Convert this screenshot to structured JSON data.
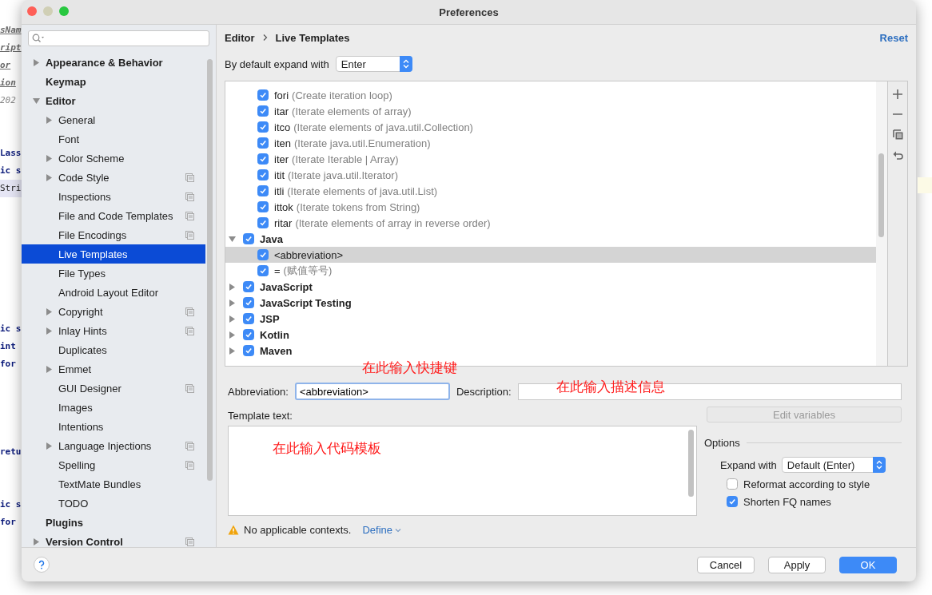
{
  "background_code": [
    {
      "kind": "doc",
      "text": "sNam"
    },
    {
      "kind": "doc",
      "text": "ript"
    },
    {
      "kind": "doc",
      "text": "or"
    },
    {
      "kind": "doc",
      "text": "ion"
    },
    {
      "kind": "comment",
      "text": "202"
    },
    {
      "kind": "blank"
    },
    {
      "kind": "blank"
    },
    {
      "kind": "code",
      "text": "Lass"
    },
    {
      "kind": "code",
      "text": "ic s"
    },
    {
      "kind": "current",
      "text": "Stri"
    },
    {
      "kind": "blank"
    },
    {
      "kind": "blank"
    },
    {
      "kind": "blank"
    },
    {
      "kind": "blank"
    },
    {
      "kind": "blank"
    },
    {
      "kind": "blank"
    },
    {
      "kind": "blank"
    },
    {
      "kind": "code",
      "text": "ic s"
    },
    {
      "kind": "code",
      "text": "int"
    },
    {
      "kind": "code",
      "text": "for"
    },
    {
      "kind": "blank"
    },
    {
      "kind": "blank"
    },
    {
      "kind": "blank"
    },
    {
      "kind": "blank"
    },
    {
      "kind": "code",
      "text": "retu"
    },
    {
      "kind": "blank"
    },
    {
      "kind": "blank"
    },
    {
      "kind": "code",
      "text": "ic s"
    },
    {
      "kind": "code",
      "text": "for"
    }
  ],
  "window": {
    "title": "Preferences"
  },
  "sidebar": {
    "items": [
      {
        "label": "Appearance & Behavior",
        "expanded": false,
        "selected": false
      },
      {
        "label": "Keymap",
        "selected": false
      },
      {
        "label": "Editor",
        "expanded": true,
        "selected": false,
        "children": [
          {
            "label": "General",
            "expanded": false,
            "selected": false
          },
          {
            "label": "Font",
            "selected": false
          },
          {
            "label": "Color Scheme",
            "expanded": false,
            "selected": false
          },
          {
            "label": "Code Style",
            "expanded": false,
            "selected": false,
            "project_icon": true
          },
          {
            "label": "Inspections",
            "selected": false,
            "project_icon": true
          },
          {
            "label": "File and Code Templates",
            "selected": false,
            "project_icon": true
          },
          {
            "label": "File Encodings",
            "selected": false,
            "project_icon": true
          },
          {
            "label": "Live Templates",
            "selected": true
          },
          {
            "label": "File Types",
            "selected": false
          },
          {
            "label": "Android Layout Editor",
            "selected": false
          },
          {
            "label": "Copyright",
            "expanded": false,
            "selected": false,
            "project_icon": true
          },
          {
            "label": "Inlay Hints",
            "expanded": false,
            "selected": false,
            "project_icon": true
          },
          {
            "label": "Duplicates",
            "selected": false
          },
          {
            "label": "Emmet",
            "expanded": false,
            "selected": false
          },
          {
            "label": "GUI Designer",
            "selected": false,
            "project_icon": true
          },
          {
            "label": "Images",
            "selected": false
          },
          {
            "label": "Intentions",
            "selected": false
          },
          {
            "label": "Language Injections",
            "expanded": false,
            "selected": false,
            "project_icon": true
          },
          {
            "label": "Spelling",
            "selected": false,
            "project_icon": true
          },
          {
            "label": "TextMate Bundles",
            "selected": false
          },
          {
            "label": "TODO",
            "selected": false
          }
        ]
      },
      {
        "label": "Plugins",
        "selected": false
      },
      {
        "label": "Version Control",
        "expanded": false,
        "selected": false,
        "project_icon": true
      }
    ]
  },
  "breadcrumb": [
    "Editor",
    "Live Templates"
  ],
  "reset_link": "Reset",
  "expand_default": {
    "label": "By default expand with",
    "value": "Enter"
  },
  "tree": {
    "items": [
      {
        "children": [
          {
            "name": "fori",
            "description": "(Create iteration loop)",
            "checked": true,
            "selected": false
          },
          {
            "name": "itar",
            "description": "(Iterate elements of array)",
            "checked": true,
            "selected": false
          },
          {
            "name": "itco",
            "description": "(Iterate elements of java.util.Collection)",
            "checked": true,
            "selected": false
          },
          {
            "name": "iten",
            "description": "(Iterate java.util.Enumeration)",
            "checked": true,
            "selected": false
          },
          {
            "name": "iter",
            "description": "(Iterate Iterable | Array)",
            "checked": true,
            "selected": false
          },
          {
            "name": "itit",
            "description": "(Iterate java.util.Iterator)",
            "checked": true,
            "selected": false
          },
          {
            "name": "itli",
            "description": "(Iterate elements of java.util.List)",
            "checked": true,
            "selected": false
          },
          {
            "name": "ittok",
            "description": "(Iterate tokens from String)",
            "checked": true,
            "selected": false
          },
          {
            "name": "ritar",
            "description": "(Iterate elements of array in reverse order)",
            "checked": true,
            "selected": false
          }
        ]
      },
      {
        "name": "Java",
        "checked": true,
        "expanded": true,
        "children": [
          {
            "name": "<abbreviation>",
            "checked": true,
            "selected": true
          },
          {
            "name": "=",
            "description": "(赋值等号)",
            "checked": true,
            "selected": false
          }
        ]
      },
      {
        "name": "JavaScript",
        "checked": true,
        "expanded": false
      },
      {
        "name": "JavaScript Testing",
        "checked": true,
        "expanded": false
      },
      {
        "name": "JSP",
        "checked": true,
        "expanded": false
      },
      {
        "name": "Kotlin",
        "checked": true,
        "expanded": false
      },
      {
        "name": "Maven",
        "checked": true,
        "expanded": false
      }
    ]
  },
  "form": {
    "abbreviation": {
      "label": "Abbreviation:",
      "value": "<abbreviation>"
    },
    "description": {
      "label": "Description:"
    },
    "template_text": {
      "label": "Template text:"
    },
    "edit_variables": {
      "label": "Edit variables",
      "disabled": true
    },
    "options": {
      "title": "Options",
      "expand_with": {
        "label": "Expand with",
        "value": "Default (Enter)"
      },
      "checkboxes": [
        {
          "label": "Reformat according to style",
          "checked": false
        },
        {
          "label": "Shorten FQ names",
          "checked": true
        }
      ]
    },
    "warning": {
      "text": "No applicable contexts.",
      "link": "Define"
    }
  },
  "annotations": [
    "在此输入快捷键",
    "在此输入描述信息",
    "在此输入代码模板"
  ],
  "buttons": [
    {
      "label": "Cancel",
      "primary": false
    },
    {
      "label": "Apply",
      "primary": false
    },
    {
      "label": "OK",
      "primary": true
    }
  ]
}
